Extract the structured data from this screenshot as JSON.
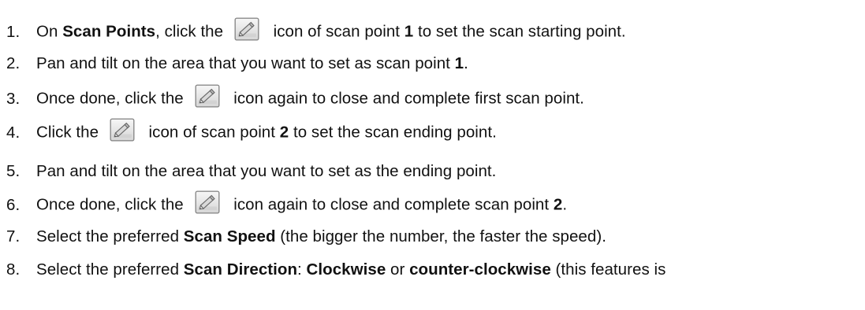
{
  "steps": [
    {
      "number": "1.",
      "segments": [
        {
          "type": "text",
          "text": "On "
        },
        {
          "type": "bold",
          "text": "Scan Points"
        },
        {
          "type": "text",
          "text": ", click the "
        },
        {
          "type": "icon",
          "icon": "edit-pencil-icon"
        },
        {
          "type": "text",
          "text": " icon of scan point "
        },
        {
          "type": "bold",
          "text": "1"
        },
        {
          "type": "text",
          "text": " to set the scan starting point."
        }
      ]
    },
    {
      "number": "2.",
      "segments": [
        {
          "type": "text",
          "text": "Pan and tilt on the area that you want to set as scan point "
        },
        {
          "type": "bold",
          "text": "1"
        },
        {
          "type": "text",
          "text": "."
        }
      ]
    },
    {
      "number": "3.",
      "segments": [
        {
          "type": "text",
          "text": "Once done, click the "
        },
        {
          "type": "icon",
          "icon": "edit-pencil-icon"
        },
        {
          "type": "text",
          "text": " icon again to close and complete first scan point."
        }
      ]
    },
    {
      "number": "4.",
      "segments": [
        {
          "type": "text",
          "text": "Click the "
        },
        {
          "type": "icon",
          "icon": "edit-pencil-icon"
        },
        {
          "type": "text",
          "text": " icon of scan point "
        },
        {
          "type": "bold",
          "text": "2"
        },
        {
          "type": "text",
          "text": " to set the scan ending point."
        }
      ]
    },
    {
      "number": "5.",
      "segments": [
        {
          "type": "text",
          "text": "Pan and tilt on the area that you want to set as the ending point."
        }
      ]
    },
    {
      "number": "6.",
      "segments": [
        {
          "type": "text",
          "text": "Once done, click the "
        },
        {
          "type": "icon",
          "icon": "edit-pencil-icon"
        },
        {
          "type": "text",
          "text": " icon again to close and complete scan point "
        },
        {
          "type": "bold",
          "text": "2"
        },
        {
          "type": "text",
          "text": "."
        }
      ]
    },
    {
      "number": "7.",
      "segments": [
        {
          "type": "text",
          "text": "Select the preferred "
        },
        {
          "type": "bold",
          "text": "Scan Speed"
        },
        {
          "type": "text",
          "text": " (the bigger the number, the faster the speed)."
        }
      ]
    },
    {
      "number": "8.",
      "segments": [
        {
          "type": "text",
          "text": "Select the preferred "
        },
        {
          "type": "bold",
          "text": "Scan Direction"
        },
        {
          "type": "text",
          "text": ": "
        },
        {
          "type": "bold",
          "text": "Clockwise"
        },
        {
          "type": "text",
          "text": " or "
        },
        {
          "type": "bold",
          "text": "counter-clockwise"
        },
        {
          "type": "text",
          "text": " (this features is"
        }
      ]
    }
  ]
}
